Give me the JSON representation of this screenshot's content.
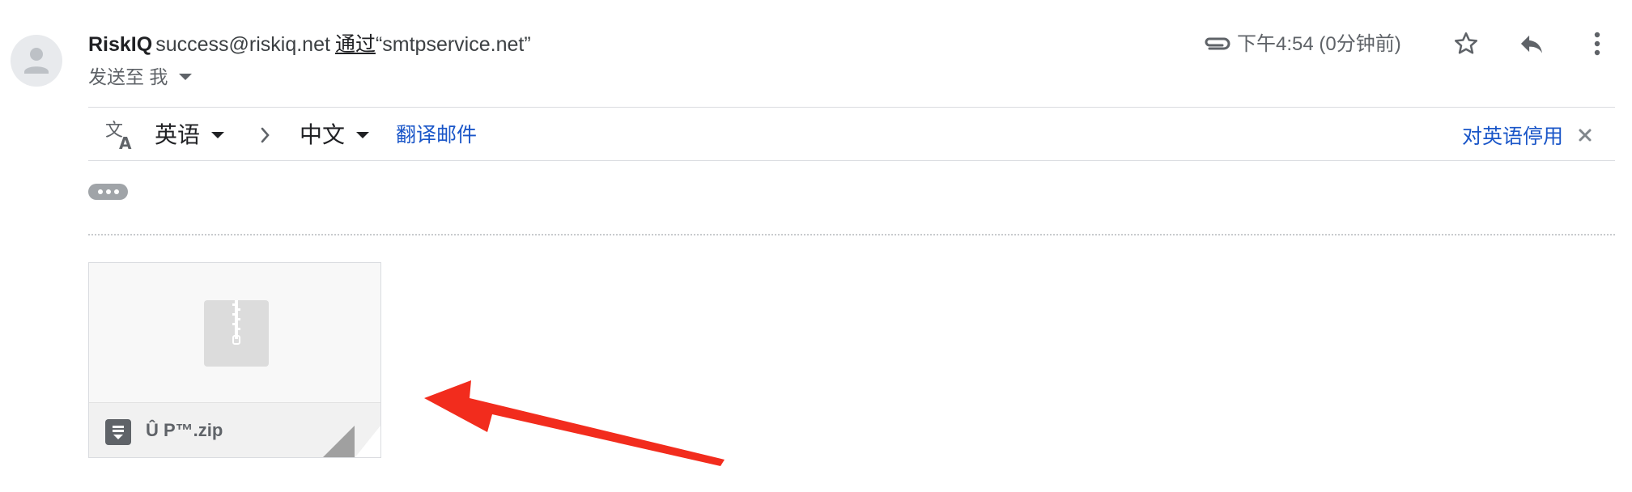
{
  "header": {
    "sender_name": "RiskIQ",
    "sender_email": "success@riskiq.net",
    "via_label": "通过",
    "via_domain": "“smtpservice.net”",
    "to_label": "发送至 我",
    "time": "下午4:54 (0分钟前)"
  },
  "translate_bar": {
    "source_language": "英语",
    "target_language": "中文",
    "translate_link": "翻译邮件",
    "disable_link": "对英语停用"
  },
  "attachment": {
    "file_name": "Û P™.zip"
  },
  "icons": {
    "avatar": "person-avatar-icon",
    "attachment": "paperclip-icon",
    "star": "star-icon",
    "reply": "reply-icon",
    "more": "more-vert-icon",
    "translate": "translate-icon",
    "file_type": "zip-file-icon",
    "annotation": "red-arrow-annotation"
  },
  "colors": {
    "link_blue": "#1a56c8",
    "annotation_red": "#f22c1d"
  }
}
